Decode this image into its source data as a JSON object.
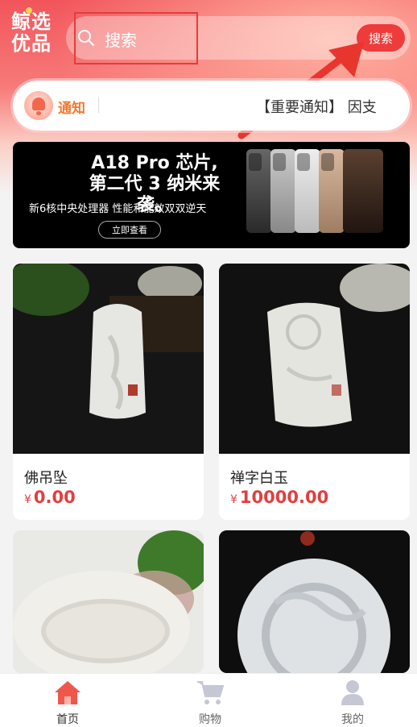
{
  "header": {
    "logo_line1": "鲸选",
    "logo_line2": "优品",
    "search_placeholder": "搜索",
    "search_button": "搜索"
  },
  "notice": {
    "label": "通知",
    "text": "【重要通知】 因支"
  },
  "banner": {
    "title_line1": "A18 Pro 芯片,",
    "title_line2": "第二代 3 纳米来袭。",
    "subtitle": "新6核中央处理器 性能和能效双双逆天",
    "button": "立即查看"
  },
  "products": [
    {
      "name": "佛吊坠",
      "currency": "¥",
      "price": "0.00"
    },
    {
      "name": "禅字白玉",
      "currency": "¥",
      "price": "10000.00"
    },
    {
      "name": "",
      "currency": "",
      "price": ""
    },
    {
      "name": "",
      "currency": "",
      "price": ""
    }
  ],
  "tabbar": {
    "items": [
      {
        "label": "首页",
        "icon": "home-icon",
        "active": true
      },
      {
        "label": "购物",
        "icon": "cart-icon",
        "active": false
      },
      {
        "label": "我的",
        "icon": "user-icon",
        "active": false
      }
    ]
  },
  "colors": {
    "accent": "#ee3b3b",
    "price": "#e13f3f",
    "notice_label": "#f17a2c",
    "active_tab": "#f0574b",
    "inactive_tab": "#c5c8d4"
  }
}
